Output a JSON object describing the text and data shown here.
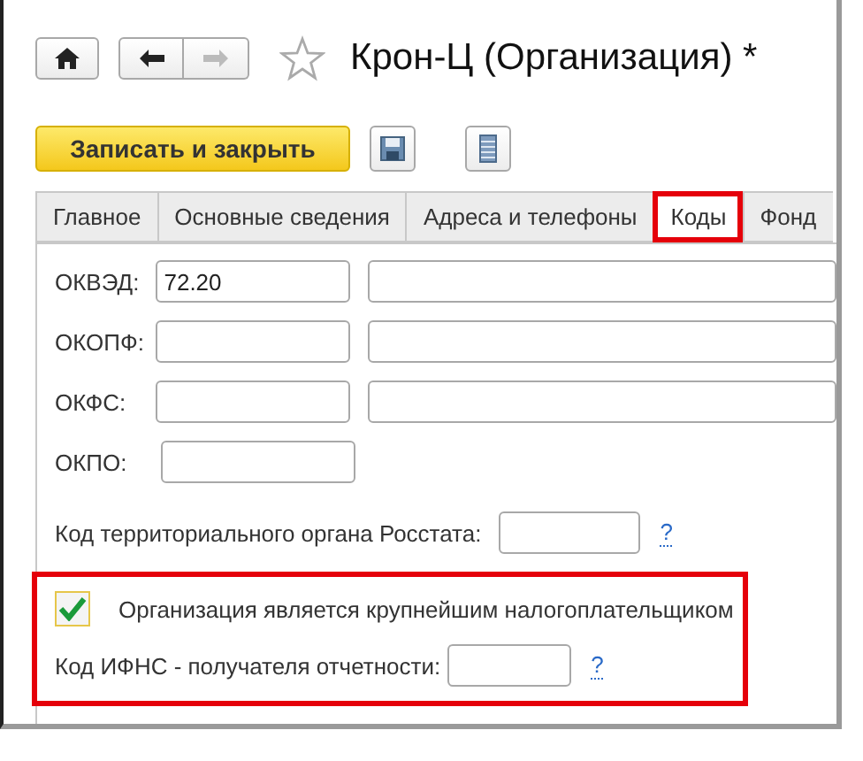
{
  "toolbar": {
    "title": "Крон-Ц (Организация) *",
    "favorite": false,
    "back_enabled": true,
    "forward_enabled": false
  },
  "actions": {
    "save_close": "Записать и закрыть"
  },
  "tabs": [
    {
      "label": "Главное",
      "selected": false,
      "highlighted": false
    },
    {
      "label": "Основные сведения",
      "selected": false,
      "highlighted": false
    },
    {
      "label": "Адреса и телефоны",
      "selected": false,
      "highlighted": false
    },
    {
      "label": "Коды",
      "selected": true,
      "highlighted": true
    },
    {
      "label": "Фонд",
      "selected": false,
      "highlighted": false
    }
  ],
  "codes": [
    {
      "label": "ОКВЭД:",
      "value": "72.20",
      "has_description": true
    },
    {
      "label": "ОКОПФ:",
      "has_description": true
    },
    {
      "label": "ОКФС:",
      "has_description": true
    },
    {
      "label": "ОКПО:",
      "has_description": false
    }
  ],
  "rosstat": {
    "label": "Код территориального органа Росстата:",
    "help": "?"
  },
  "taxpayer": {
    "highlighted": true,
    "checkbox": {
      "label": "Организация является крупнейшим налогоплательщиком",
      "checked": true
    },
    "ifns": {
      "label": "Код ИФНС - получателя отчетности:",
      "help": "?"
    }
  }
}
